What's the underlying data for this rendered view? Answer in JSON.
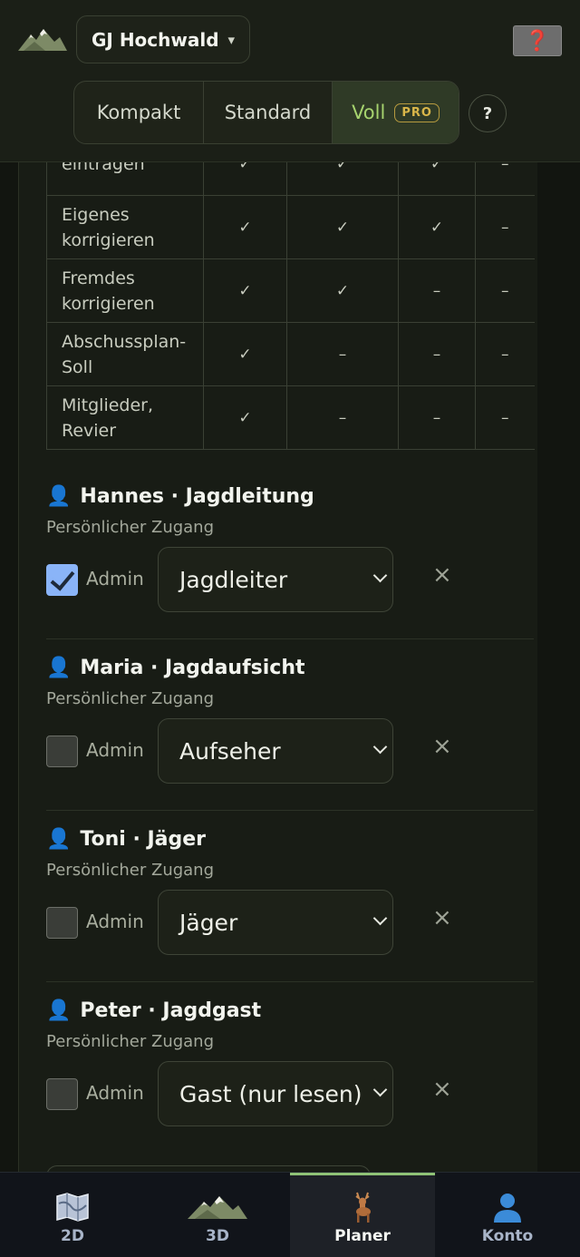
{
  "header": {
    "revier_name": "GJ Hochwald",
    "revier_caret": "▾",
    "help_red": "❓",
    "modes": [
      "Kompakt",
      "Standard",
      "Voll"
    ],
    "pro_badge": "PRO",
    "help_q": "?"
  },
  "permissions": {
    "rows": [
      {
        "label": "eintragen",
        "values": [
          "✓",
          "✓",
          "✓",
          "–"
        ]
      },
      {
        "label": "Eigenes korrigieren",
        "values": [
          "✓",
          "✓",
          "✓",
          "–"
        ]
      },
      {
        "label": "Fremdes korrigieren",
        "values": [
          "✓",
          "✓",
          "–",
          "–"
        ]
      },
      {
        "label": "Abschussplan-Soll",
        "values": [
          "✓",
          "–",
          "–",
          "–"
        ]
      },
      {
        "label": "Mitglieder, Revier",
        "values": [
          "✓",
          "–",
          "–",
          "–"
        ]
      }
    ]
  },
  "members": [
    {
      "name": "Hannes · Jagdleitung",
      "sub": "Persönlicher Zugang",
      "admin_label": "Admin",
      "admin": true,
      "role": "Jagdleiter",
      "remove": "×"
    },
    {
      "name": "Maria · Jagdaufsicht",
      "sub": "Persönlicher Zugang",
      "admin_label": "Admin",
      "admin": false,
      "role": "Aufseher",
      "remove": "×"
    },
    {
      "name": "Toni · Jäger",
      "sub": "Persönlicher Zugang",
      "admin_label": "Admin",
      "admin": false,
      "role": "Jäger",
      "remove": "×"
    },
    {
      "name": "Peter · Jagdgast",
      "sub": "Persönlicher Zugang",
      "admin_label": "Admin",
      "admin": false,
      "role": "Gast (nur lesen)",
      "remove": "×"
    }
  ],
  "person_icon": "👤",
  "nav": [
    {
      "label": "2D",
      "icon": "map-icon"
    },
    {
      "label": "3D",
      "icon": "mountain-icon"
    },
    {
      "label": "Planer",
      "icon": "deer-icon",
      "active": true
    },
    {
      "label": "Konto",
      "icon": "person-icon"
    }
  ],
  "colors": {
    "accent": "#a6d36e",
    "pro": "#d9b64a",
    "checkbox": "#8ab4f8",
    "person": "#3b8bd8"
  }
}
